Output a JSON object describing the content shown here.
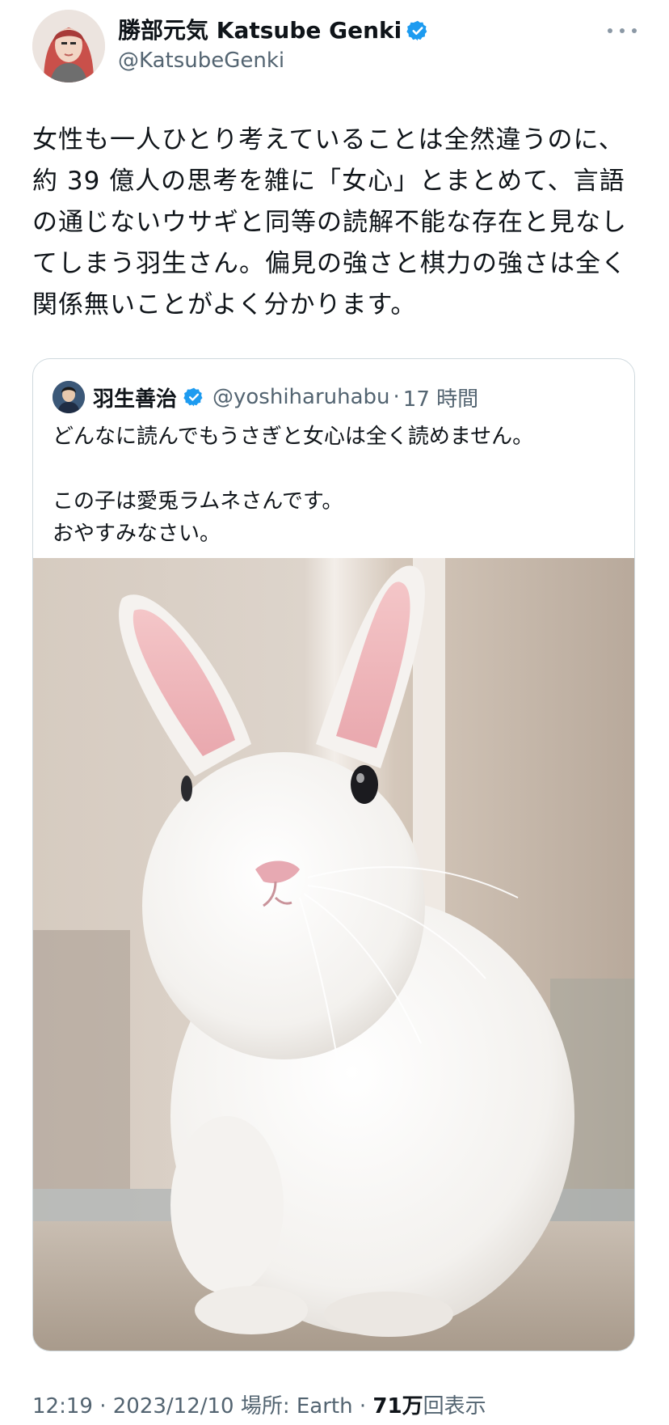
{
  "author": {
    "display_name": "勝部元気 Katsube Genki",
    "handle": "@KatsubeGenki"
  },
  "tweet": {
    "lines": [
      "女性も一人ひとり考えていることは全然違うのに、",
      "約 39 億人の思考を雑に「女心」とまとめて、言語",
      "の通じないウサギと同等の読解不能な存在と見なし",
      "てしまう羽生さん。偏見の強さと棋力の強さは全く",
      "関係無いことがよく分かります。"
    ]
  },
  "quote": {
    "display_name": "羽生善治",
    "handle": "@yoshiharuhabu",
    "separator": "·",
    "time": "17 時間",
    "lines": [
      "どんなに読んでもうさぎと女心は全く読めません。",
      "",
      "この子は愛兎ラムネさんです。",
      "おやすみなさい。"
    ]
  },
  "meta": {
    "time": "12:19",
    "dot1": "·",
    "date": "2023/12/10",
    "location_label": "場所: Earth",
    "dot2": "·",
    "views_count": "71万",
    "views_label": "回表示"
  },
  "icons": {
    "verified": "verified-badge-icon",
    "more": "more-options-icon"
  },
  "colors": {
    "verified": "#1d9bf0",
    "secondary_text": "#536471",
    "border": "#cfd9de"
  }
}
